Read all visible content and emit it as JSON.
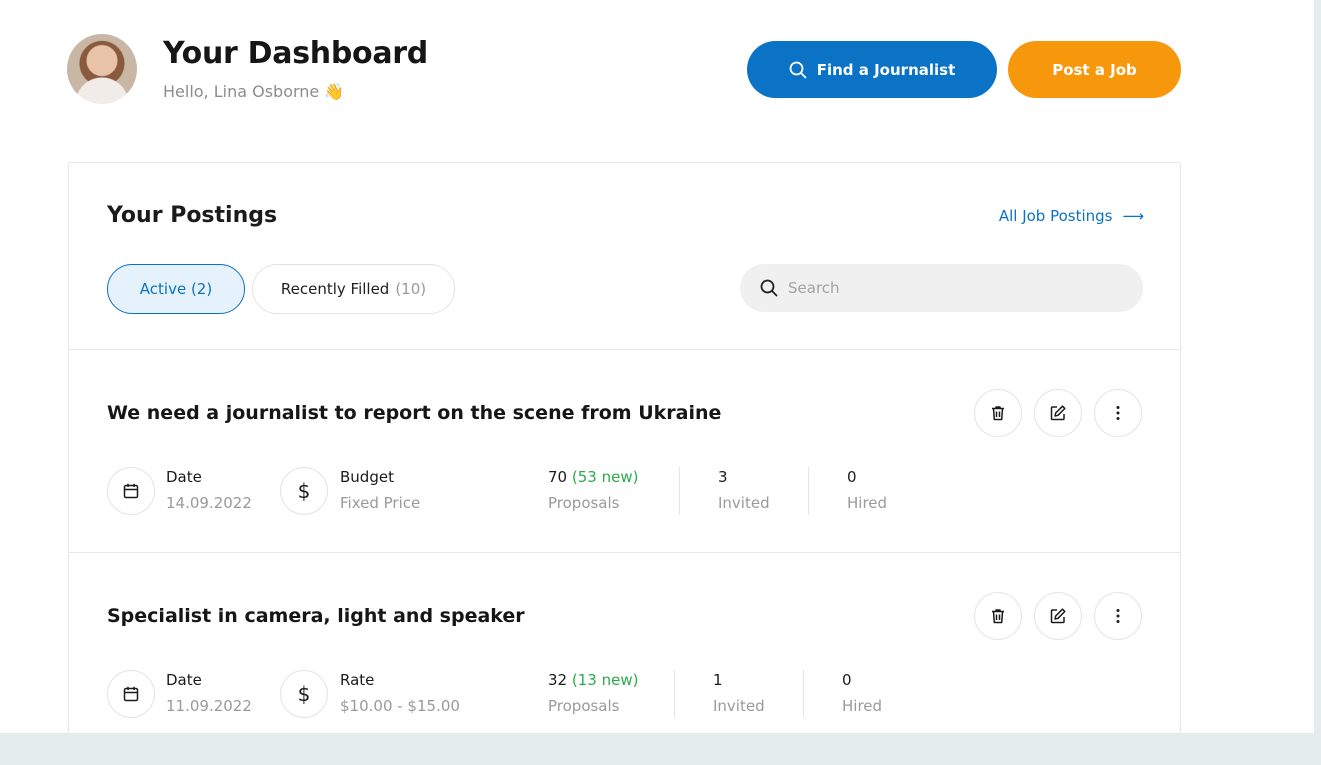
{
  "header": {
    "title": "Your Dashboard",
    "greeting": "Hello, Lina Osborne",
    "greeting_emoji": "👋",
    "find_button": "Find a Journalist",
    "post_button": "Post a Job"
  },
  "colors": {
    "primary": "#0a73c6",
    "accent": "#f7980c",
    "success": "#2bab4a"
  },
  "postings": {
    "title": "Your Postings",
    "all_link": "All Job Postings",
    "all_link_arrow": "⟶",
    "tabs": [
      {
        "label": "Active (2)",
        "active": true
      },
      {
        "label": "Recently Filled",
        "count": "(10)",
        "active": false
      }
    ],
    "search_placeholder": "Search",
    "items": [
      {
        "title": "We need a journalist to report on the scene from Ukraine",
        "date_label": "Date",
        "date": "14.09.2022",
        "budget_label": "Budget",
        "budget": "Fixed Price",
        "proposals": "70",
        "proposals_new": "(53 new)",
        "proposals_label": "Proposals",
        "invited": "3",
        "invited_label": "Invited",
        "hired": "0",
        "hired_label": "Hired"
      },
      {
        "title": "Specialist in camera, light and speaker",
        "date_label": "Date",
        "date": "11.09.2022",
        "budget_label": "Rate",
        "budget": "$10.00 - $15.00",
        "proposals": "32",
        "proposals_new": "(13 new)",
        "proposals_label": "Proposals",
        "invited": "1",
        "invited_label": "Invited",
        "hired": "0",
        "hired_label": "Hired"
      }
    ]
  },
  "icons": {
    "dollar": "$"
  }
}
